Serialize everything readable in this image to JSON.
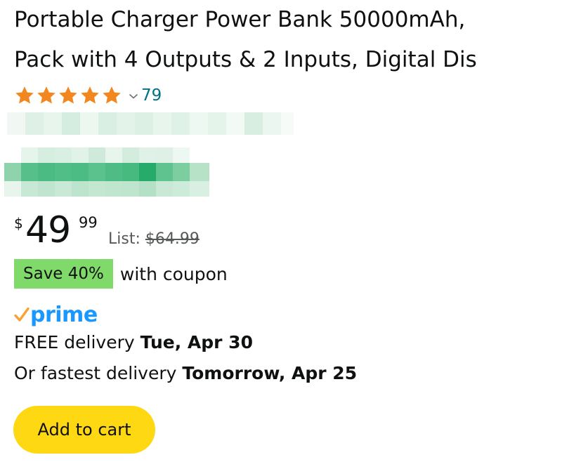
{
  "product": {
    "title_line1": "Portable Charger Power Bank 50000mAh,",
    "title_line2": "Pack with 4 Outputs & 2 Inputs, Digital Dis"
  },
  "rating": {
    "stars": 5,
    "count": "79"
  },
  "price": {
    "symbol": "$",
    "whole": "49",
    "fraction": "99",
    "list_label": "List:",
    "list_price": "$64.99"
  },
  "coupon": {
    "badge": "Save 40%",
    "text": "with coupon"
  },
  "prime": {
    "label": "prime"
  },
  "delivery": {
    "line1_prefix": "FREE delivery",
    "line1_date": "Tue, Apr 30",
    "line2_prefix": "Or fastest delivery",
    "line2_date": "Tomorrow, Apr 25"
  },
  "actions": {
    "add_to_cart": "Add to cart"
  },
  "colors": {
    "star": "#f2861f",
    "link": "#007185",
    "coupon_bg": "#7fda69",
    "prime_blue": "#1a98ff",
    "prime_check": "#f7a233",
    "cart_button": "#ffd814"
  }
}
